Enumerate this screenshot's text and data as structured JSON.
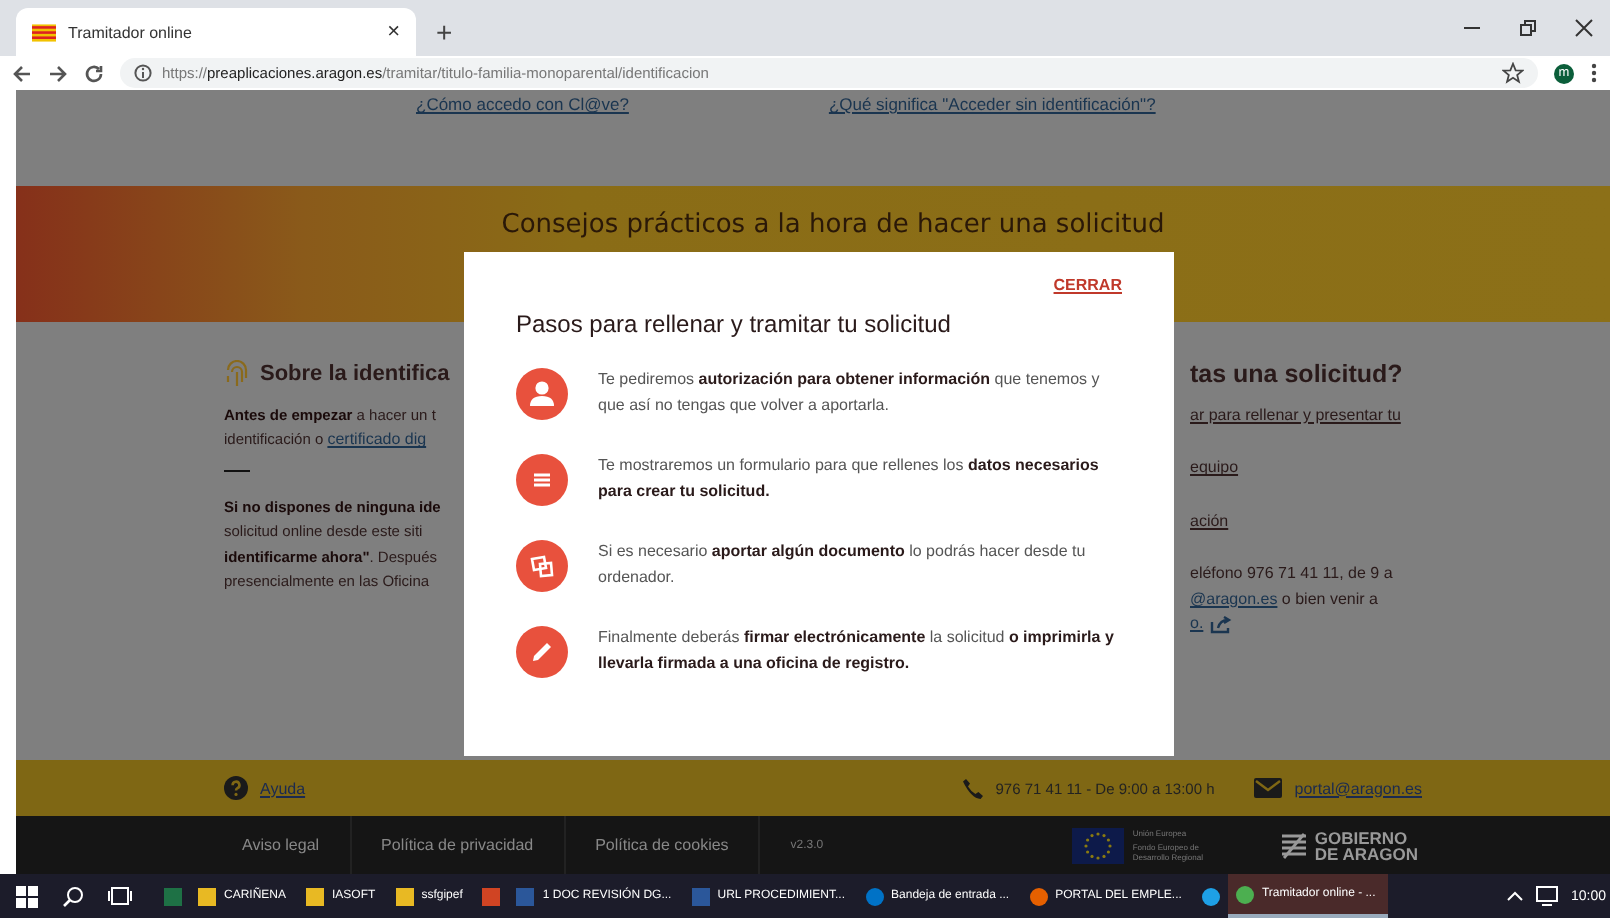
{
  "browser": {
    "tab": {
      "title": "Tramitador online",
      "close": "×"
    },
    "new_tab": "+",
    "url": {
      "scheme": "https://",
      "host": "preaplicaciones.aragon.es",
      "path": "/tramitar/titulo-familia-monoparental/identificacion"
    },
    "avatar": "m"
  },
  "top_links": [
    "¿Cómo accedo con Cl@ve?",
    "¿Qué significa \"Acceder sin identificación\"?"
  ],
  "banner": {
    "title": "Consejos prácticos a la hora de hacer una solicitud"
  },
  "left": {
    "heading": "Sobre la identifica",
    "lines": [
      {
        "kind": "text",
        "text": "**Antes de empezar** a hacer un t"
      },
      {
        "kind": "mixed",
        "text": "identificación o ",
        "link": "certificado dig"
      },
      {
        "kind": "rule"
      },
      {
        "kind": "text",
        "text": "**Si no dispones de ninguna ide**"
      },
      {
        "kind": "text",
        "text": "solicitud online desde este siti"
      },
      {
        "kind": "text",
        "text": "**identificarme ahora\"**. Después"
      },
      {
        "kind": "text",
        "text": "presencialmente en las Oficina"
      }
    ]
  },
  "right": {
    "heading": "tas una solicitud?",
    "lines": [
      {
        "kind": "link",
        "text": "ar para rellenar y presentar tu"
      },
      {
        "kind": "gap"
      },
      {
        "kind": "link",
        "text": "equipo"
      },
      {
        "kind": "gap"
      },
      {
        "kind": "link",
        "text": "ación"
      },
      {
        "kind": "gap"
      },
      {
        "kind": "text",
        "text": "eléfono 976 71 41 11, de 9 a"
      },
      {
        "kind": "mixed",
        "link": "@aragon.es",
        "text": " o bien venir a"
      },
      {
        "kind": "external",
        "text": "o."
      }
    ]
  },
  "modal": {
    "close": "CERRAR",
    "title": "Pasos para rellenar y tramitar tu solicitud",
    "steps": [
      {
        "kind": "person",
        "text": "Te pediremos **autorización para obtener información** que tenemos y que así no tengas que volver a aportarla."
      },
      {
        "kind": "menu",
        "text": "Te mostraremos un formulario para que rellenes los **datos necesarios para crear tu solicitud.**"
      },
      {
        "kind": "documents",
        "text": "Si es necesario **aportar algún documento** lo podrás hacer desde tu ordenador."
      },
      {
        "kind": "pencil",
        "text": "Finalmente deberás **firmar electrónicamente** la solicitud **o imprimirla y llevarla firmada a una oficina de registro.**"
      }
    ]
  },
  "footer": {
    "help": "Ayuda",
    "phone": "976 71 41 11 - De 9:00 a 13:00 h",
    "email": "portal@aragon.es"
  },
  "legal": {
    "links": [
      "Aviso legal",
      "Política de privacidad",
      "Política de cookies"
    ],
    "version": "v2.3.0",
    "eu": [
      "Unión Europea",
      "Fondo Europeo de Desarrollo Regional"
    ],
    "gov": [
      "GOBIERNO",
      "DE ARAGON"
    ]
  },
  "taskbar": {
    "items": [
      {
        "kind": "excel",
        "selected": false
      },
      {
        "kind": "folder",
        "label": "CARIÑENA",
        "selected": false
      },
      {
        "kind": "folder",
        "label": "IASOFT",
        "selected": false
      },
      {
        "kind": "folder",
        "label": "ssfgipef",
        "selected": false
      },
      {
        "kind": "ppt",
        "selected": false
      },
      {
        "kind": "word",
        "label": "1 DOC REVISIÓN DG...",
        "selected": false
      },
      {
        "kind": "word",
        "label": "URL PROCEDIMIENT...",
        "selected": false
      },
      {
        "kind": "mail",
        "label": "Bandeja de entrada ...",
        "selected": false
      },
      {
        "kind": "firefox",
        "label": "PORTAL DEL EMPLE...",
        "selected": false
      },
      {
        "kind": "ie",
        "selected": false
      },
      {
        "kind": "chrome",
        "label": "Tramitador online - ...",
        "selected": true
      }
    ],
    "clock": "10:00"
  }
}
